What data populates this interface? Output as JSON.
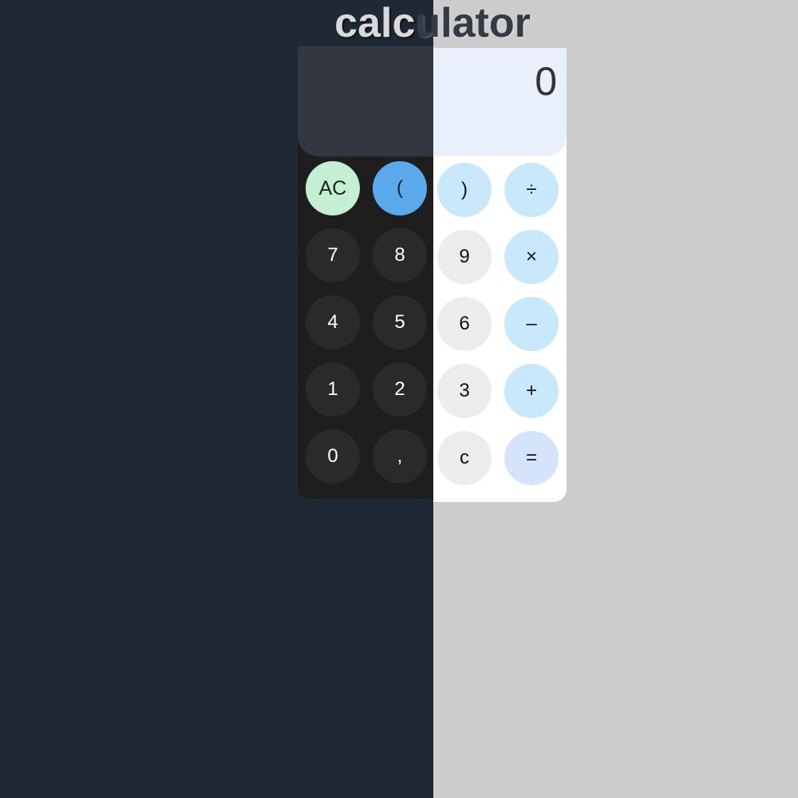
{
  "header": {
    "title_left": "calc",
    "title_right": "ulator"
  },
  "display": {
    "value": "0"
  },
  "keys": {
    "ac": "AC",
    "paren_open": "(",
    "paren_close": ")",
    "divide": "÷",
    "seven": "7",
    "eight": "8",
    "nine": "9",
    "multiply": "×",
    "four": "4",
    "five": "5",
    "six": "6",
    "minus": "–",
    "one": "1",
    "two": "2",
    "three": "3",
    "plus": "+",
    "zero": "0",
    "comma": ",",
    "clear": "c",
    "equals": "="
  },
  "colors": {
    "dark_background": "#1f2935",
    "light_background": "#cccccc",
    "ac_key": "#c5efd2",
    "paren_key": "#5aa9ea",
    "operator_key": "#c9e8fb",
    "equals_key": "#d5e3fb"
  }
}
